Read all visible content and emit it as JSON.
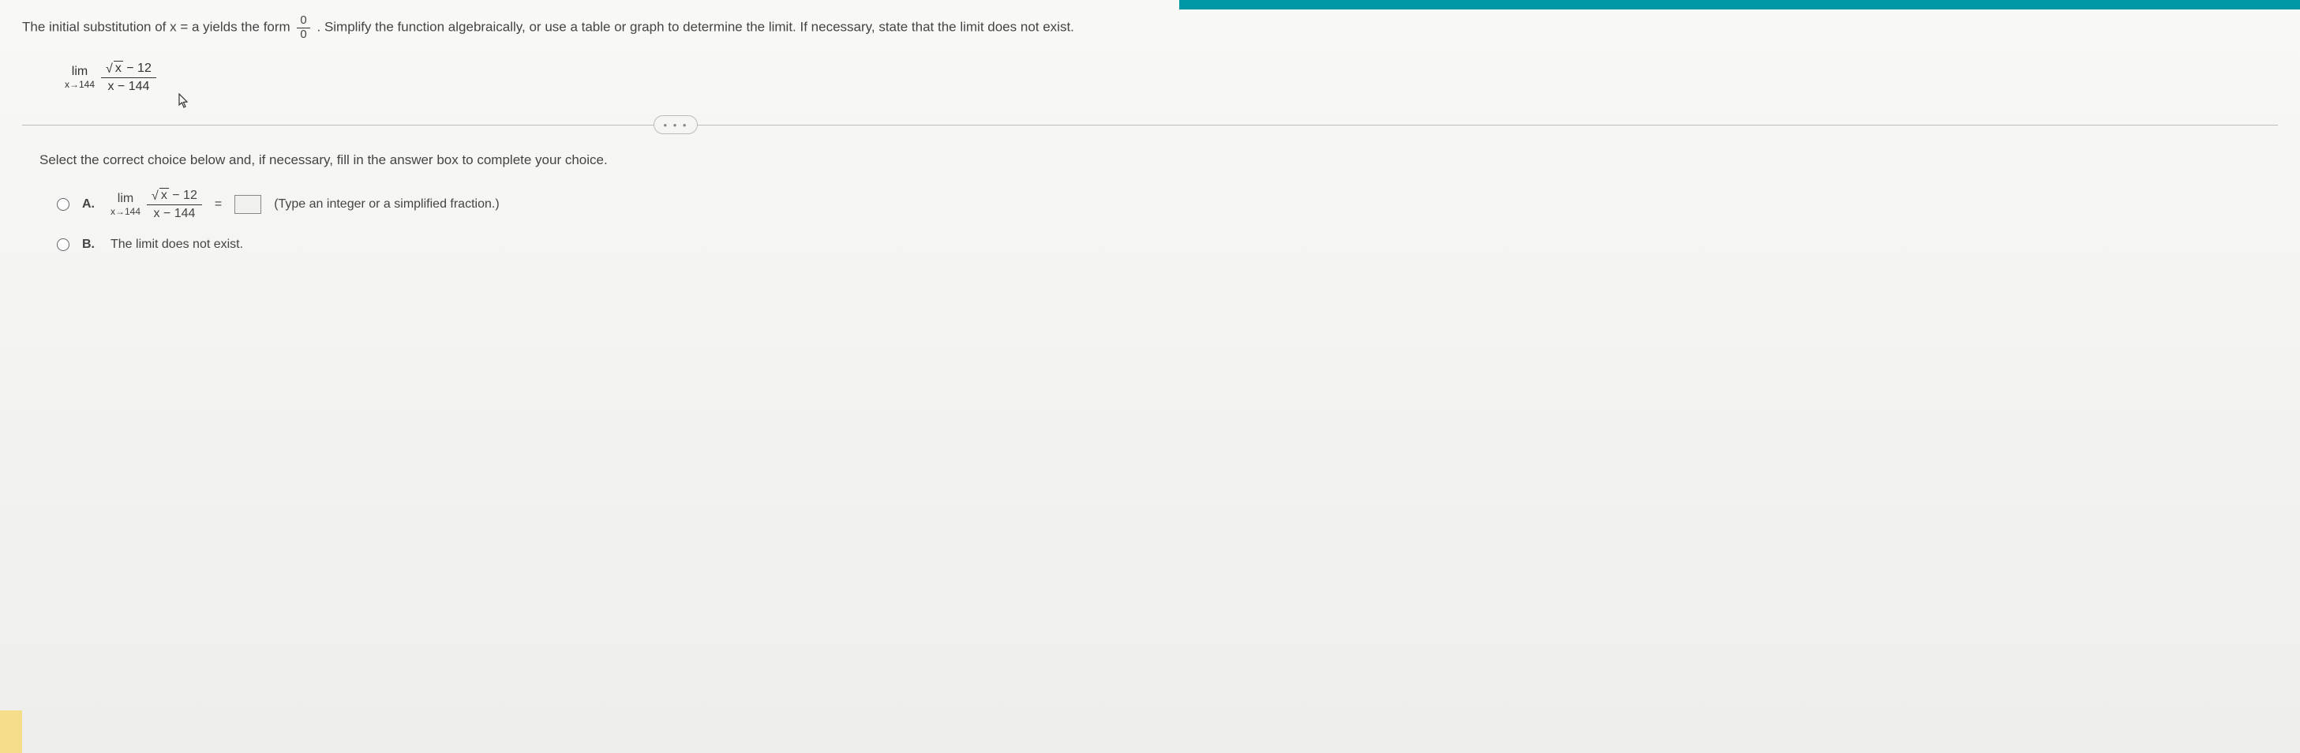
{
  "instruction": {
    "part1": "The initial substitution of x = a yields the form ",
    "frac_num": "0",
    "frac_den": "0",
    "part2": ". Simplify the function algebraically, or use a table or graph to determine the limit. If necessary, state that the limit does not exist."
  },
  "limit": {
    "lim_label": "lim",
    "lim_sub": "x→144",
    "numerator_radicand": "x",
    "numerator_tail": " − 12",
    "denominator": "x − 144"
  },
  "more_label": "• • •",
  "prompt": "Select the correct choice below and, if necessary, fill in the answer box to complete your choice.",
  "choices": {
    "A": {
      "letter": "A.",
      "lim_label": "lim",
      "lim_sub": "x→144",
      "numerator_radicand": "x",
      "numerator_tail": " − 12",
      "denominator": "x − 144",
      "equals": "=",
      "hint": "(Type an integer or a simplified fraction.)"
    },
    "B": {
      "letter": "B.",
      "text": "The limit does not exist."
    }
  }
}
